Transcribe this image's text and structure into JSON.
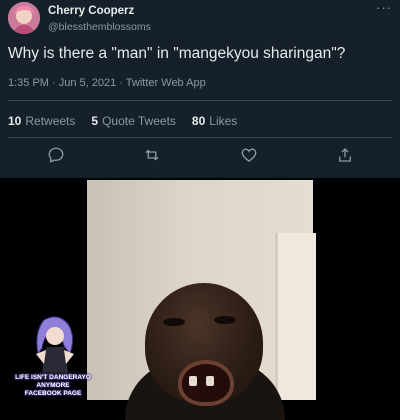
{
  "tweet": {
    "display_name": "Cherry Cooperz",
    "handle": "@blessthemblossoms",
    "more_label": "···",
    "text": "Why is there a \"man\" in \"mangekyou sharingan\"?",
    "timestamp": "1:35 PM · Jun 5, 2021 · Twitter Web App",
    "stats": [
      {
        "count": "10",
        "label": "Retweets"
      },
      {
        "count": "5",
        "label": "Quote Tweets"
      },
      {
        "count": "80",
        "label": "Likes"
      }
    ],
    "actions": [
      "reply-icon",
      "retweet-icon",
      "like-icon",
      "share-icon"
    ],
    "colors": {
      "background": "#15202b",
      "text": "#e7e9ea",
      "muted": "#8b98a5",
      "divider": "#38444d"
    }
  },
  "meme": {
    "sticker_caption_line1": "LIFE ISN'T DANGERAYO ANYMORE",
    "sticker_caption_line2": "FACEBOOK PAGE"
  }
}
